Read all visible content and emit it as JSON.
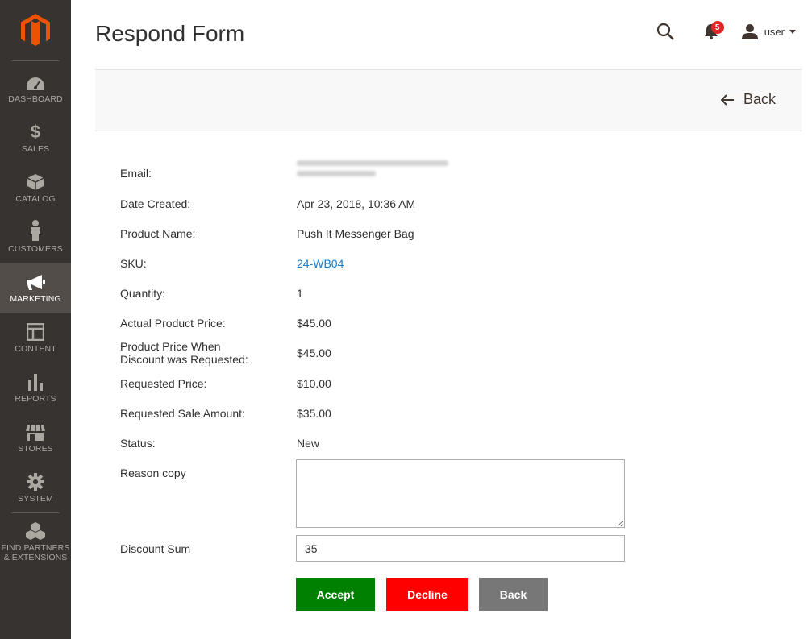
{
  "sidebar": {
    "items": [
      {
        "label": "Dashboard",
        "icon": "dashboard-icon"
      },
      {
        "label": "Sales",
        "icon": "dollar-icon"
      },
      {
        "label": "Catalog",
        "icon": "box-icon"
      },
      {
        "label": "Customers",
        "icon": "person-icon"
      },
      {
        "label": "Marketing",
        "icon": "megaphone-icon",
        "active": true
      },
      {
        "label": "Content",
        "icon": "layout-icon"
      },
      {
        "label": "Reports",
        "icon": "bar-chart-icon"
      },
      {
        "label": "Stores",
        "icon": "store-icon"
      },
      {
        "label": "System",
        "icon": "gear-icon"
      }
    ],
    "partners": {
      "line1": "Find Partners",
      "line2": "& Extensions",
      "icon": "cubes-icon"
    }
  },
  "header": {
    "title": "Respond Form",
    "notifications_count": "5",
    "user_name": "user"
  },
  "actionbar": {
    "back_label": "Back"
  },
  "form": {
    "email_label": "Email:",
    "date_label": "Date Created:",
    "date_value": "Apr 23, 2018, 10:36 AM",
    "product_label": "Product Name:",
    "product_value": "Push It Messenger Bag",
    "sku_label": "SKU:",
    "sku_value": "24-WB04",
    "qty_label": "Quantity:",
    "qty_value": "1",
    "actual_price_label": "Actual Product Price:",
    "actual_price_value": "$45.00",
    "price_when_label_1": "Product Price When",
    "price_when_label_2": "Discount was Requested:",
    "price_when_value": "$45.00",
    "requested_price_label": "Requested Price:",
    "requested_price_value": "$10.00",
    "requested_sale_label": "Requested Sale Amount:",
    "requested_sale_value": "$35.00",
    "status_label": "Status:",
    "status_value": "New",
    "reason_label": "Reason copy",
    "reason_value": "",
    "discount_label": "Discount Sum",
    "discount_value": "35"
  },
  "buttons": {
    "accept": "Accept",
    "decline": "Decline",
    "back": "Back"
  },
  "colors": {
    "accent_orange": "#eb5202",
    "accept": "#008000",
    "decline": "#ff0000",
    "back": "#777777",
    "link": "#1979c3"
  }
}
